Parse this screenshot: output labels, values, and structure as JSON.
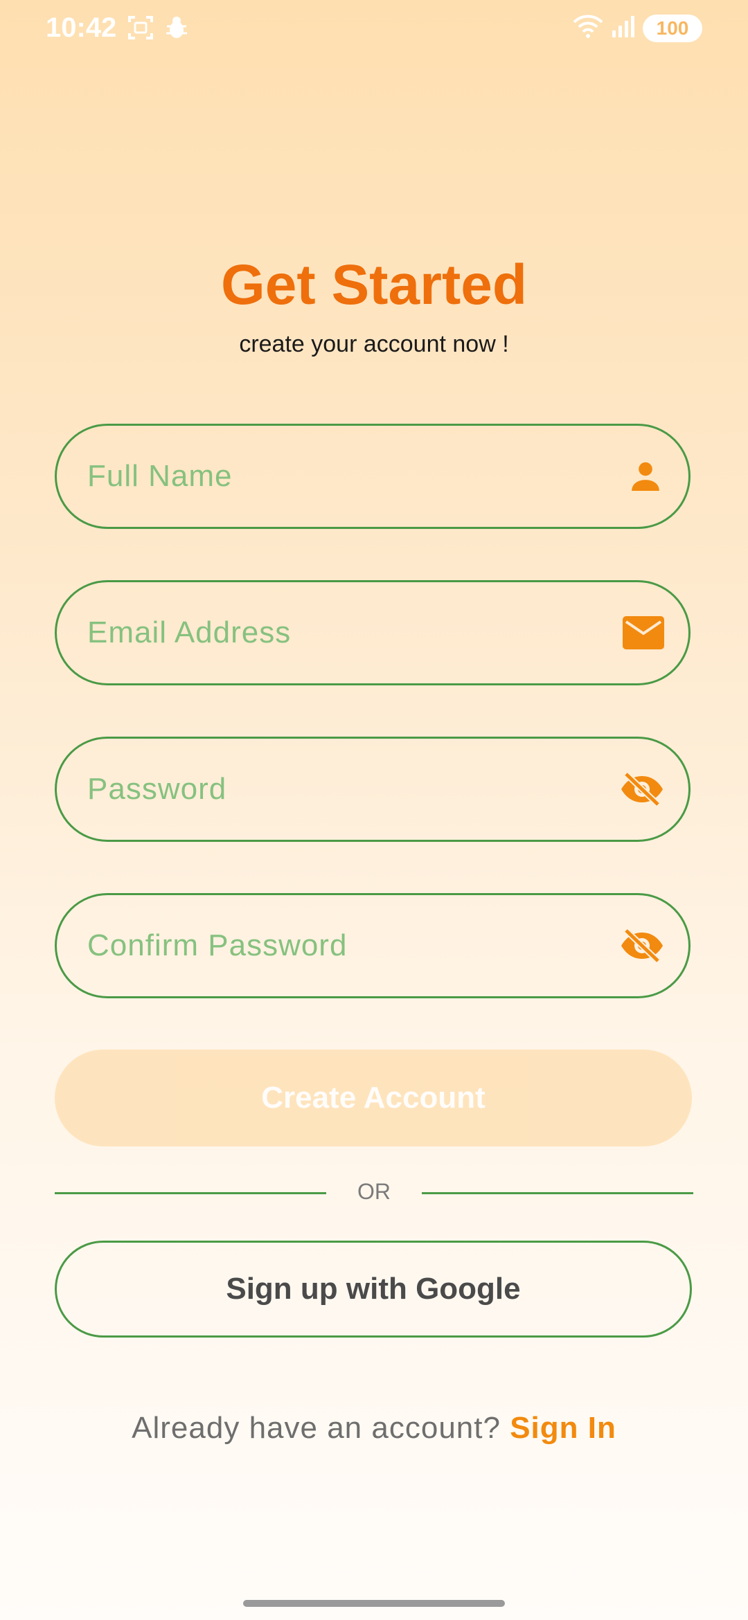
{
  "status_bar": {
    "time": "10:42",
    "battery": "100",
    "icons": [
      "screenshot-icon",
      "bug-icon",
      "wifi-icon",
      "signal-icon"
    ]
  },
  "header": {
    "title": "Get Started",
    "subtitle": "create your account now !"
  },
  "form": {
    "full_name": {
      "placeholder": "Full Name",
      "icon": "person-icon"
    },
    "email": {
      "placeholder": "Email Address",
      "icon": "mail-icon"
    },
    "password": {
      "placeholder": "Password",
      "icon": "eye-off-icon"
    },
    "confirm_password": {
      "placeholder": "Confirm Password",
      "icon": "eye-off-icon"
    },
    "create_button": "Create Account"
  },
  "divider": {
    "text": "OR"
  },
  "google_button": "Sign up with Google",
  "footer": {
    "prompt": "Already have an account? ",
    "link": "Sign In"
  },
  "colors": {
    "accent": "#EE6F0C",
    "border": "#4A9A46",
    "placeholder": "#86C17F",
    "icon": "#F28A0F"
  }
}
